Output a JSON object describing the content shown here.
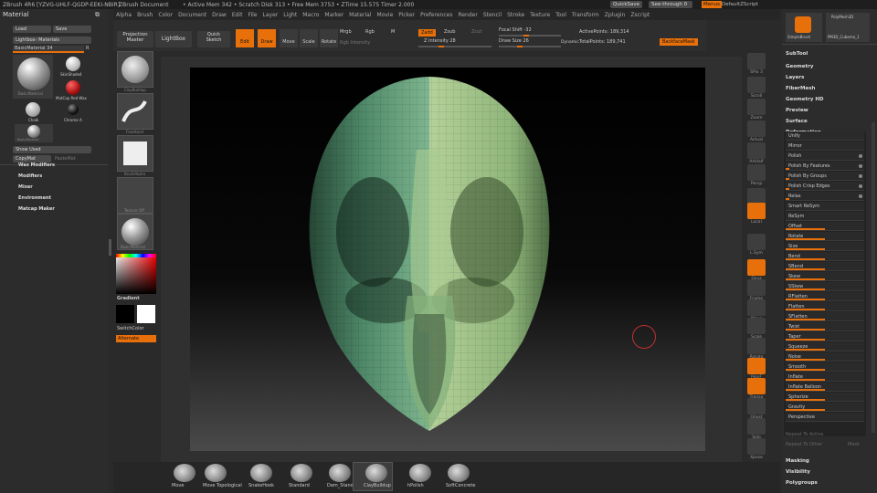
{
  "titlebar": {
    "app": "ZBrush 4R6 [YZVG-UHLF-QGDP-EEKI-NBIR]",
    "doc": "ZBrush Document",
    "stats": "• Active Mem 342 • Scratch Disk 313 • Free Mem 3753 • ZTime 15.575 Timer 2.000",
    "quicksave": "QuickSave",
    "seethrough": "See-through",
    "seethrough_val": "0",
    "menus": "Menus",
    "script": "DefaultZScript"
  },
  "menubar": [
    "Alpha",
    "Brush",
    "Color",
    "Document",
    "Draw",
    "Edit",
    "File",
    "Layer",
    "Light",
    "Macro",
    "Marker",
    "Material",
    "Movie",
    "Picker",
    "Preferences",
    "Render",
    "Stencil",
    "Stroke",
    "Texture",
    "Tool",
    "Transform",
    "Zplugin",
    "Zscript"
  ],
  "toolbar": {
    "projection_master": "Projection Master",
    "lightbox": "LightBox",
    "quick_sketch": "Quick Sketch",
    "edit": "Edit",
    "draw": "Draw",
    "move": "Move",
    "scale": "Scale",
    "rotate": "Rotate",
    "mrgb": "Mrgb",
    "rgb": "Rgb",
    "m": "M",
    "zadd": "Zadd",
    "zsub": "Zsub",
    "zcut": "Zcut",
    "rgb_intensity": "Rgb Intensity",
    "z_intensity": "Z Intensity 28",
    "focal_shift": "Focal Shift -32",
    "draw_size": "Draw Size 26",
    "dynamic": "Dynamic",
    "active_points": "ActivePoints: 189,314",
    "total_points": "TotalPoints: 189,741",
    "backface_mask": "BackfaceMask"
  },
  "leftpal": {
    "title": "Material",
    "load": "Load",
    "save": "Save",
    "lightbox_materials": "Lightbox› Materials",
    "basic_material": "BasicMaterial  34",
    "r": "R",
    "materials": [
      "BasicMaterial",
      "SkinShade4",
      "MatCap Red Wax",
      "Chalk",
      "Chrome A",
      "BasicMaterial"
    ],
    "show_used": "Show Used",
    "copymat": "CopyMat",
    "pastemat": "PasteMat",
    "sections": [
      "Wax Modifiers",
      "Modifiers",
      "Mixer",
      "Environment",
      "Matcap Maker"
    ]
  },
  "leftshelf": {
    "labels": [
      "ClayBuildup",
      "FreeHand",
      "BrushAlpha",
      "Texture Off",
      "BasicMaterial"
    ],
    "gradient": "Gradient",
    "switchcolor": "SwitchColor",
    "alternate": "Alternate"
  },
  "rightshelf": [
    "SPix 3",
    "Scroll",
    "Zoom",
    "Actual",
    "AAHalf",
    "Persp",
    "Floor",
    "Local",
    "L.Sym",
    "Qxyz",
    "Frame",
    "Move",
    "Scale",
    "Rotate",
    "PolyF",
    "Transp",
    "Ghost",
    "Solo",
    "Xpose"
  ],
  "rightpal": {
    "thumbs": [
      "SimpleBrush",
      "PolyMesh3D",
      "PM3D_Cubemo_1"
    ],
    "sections": [
      "SubTool",
      "Geometry",
      "Layers",
      "FiberMesh",
      "Geometry HD",
      "Preview",
      "Surface",
      "Deformation"
    ],
    "deform_items": [
      "Unify",
      "Mirror",
      "Polish",
      "Polish By Features",
      "Polish By Groups",
      "Polish Crisp Edges",
      "Relax",
      "Smart ReSym",
      "ReSym",
      "Offset",
      "Rotate",
      "Size",
      "Bend",
      "SBend",
      "Skew",
      "SSkew",
      "RFlatten",
      "Flatten",
      "SFlatten",
      "Twist",
      "Taper",
      "Squeeze",
      "Noise",
      "Smooth",
      "Inflate",
      "Inflate Balloon",
      "Spherize",
      "Gravity",
      "Perspective"
    ],
    "deform_vals": [
      0,
      0,
      0,
      0.05,
      0.05,
      0.05,
      0.05,
      0,
      0,
      0.5,
      0.5,
      0.5,
      0.5,
      0.5,
      0.5,
      0.5,
      0.5,
      0.5,
      0.5,
      0.5,
      0.5,
      0.5,
      0.5,
      0.5,
      0.5,
      0.5,
      0.5,
      0.5,
      0
    ],
    "repeat_active": "Repeat To Active",
    "repeat_other": "Repeat To Other",
    "mask": "Mask",
    "bottom_sections": [
      "Masking",
      "Visibility",
      "Polygroups"
    ]
  },
  "bottom": {
    "brushes": [
      "Move",
      "Move Topological",
      "SnakeHook",
      "Standard",
      "Dam_Standard",
      "ClayBuildup",
      "hPolish",
      "SoftConcrete"
    ],
    "selected": "ClayBuildup"
  },
  "colors": {
    "accent": "#e8700a",
    "mesh_light": "#c3d9a2",
    "mesh_dark": "#4f8a6a",
    "cursor_ring": "#c03030"
  }
}
